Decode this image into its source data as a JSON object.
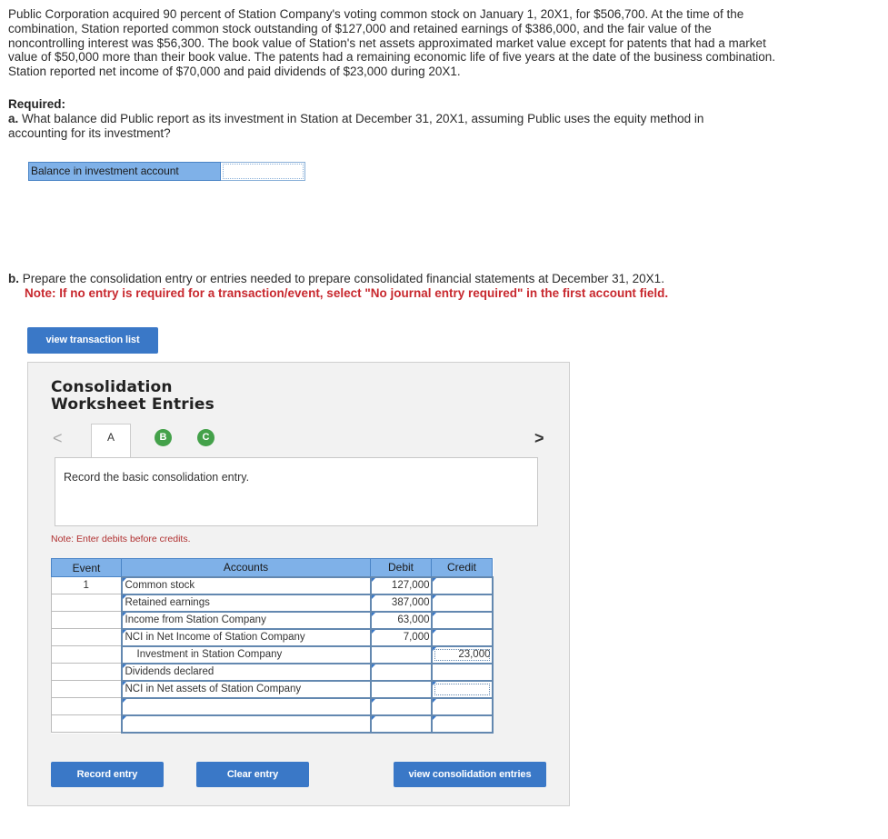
{
  "problem_text": "Public Corporation acquired 90 percent of Station Company's voting common stock on January 1, 20X1, for $506,700. At the time of the combination, Station reported common stock outstanding of $127,000 and retained earnings of $386,000, and the fair value of the noncontrolling interest was $56,300. The book value of Station's net assets approximated market value except for patents that had a market value of $50,000 more than their book value. The patents had a remaining economic life of five years at the date of the business combination. Station reported net income of $70,000 and paid dividends of $23,000 during 20X1.",
  "required_heading": "Required:",
  "part_a": {
    "letter": "a.",
    "question": "What balance did Public report as its investment in Station at December 31, 20X1, assuming Public uses the equity method in accounting for its investment?",
    "balance_label": "Balance in investment account",
    "balance_value": ""
  },
  "part_b": {
    "letter": "b.",
    "question": "Prepare the consolidation entry or entries needed to prepare consolidated financial statements at December 31, 20X1.",
    "note": "Note: If no entry is required for a transaction/event, select \"No journal entry required\" in the first account field."
  },
  "buttons": {
    "view_transaction_list": "view transaction list",
    "record_entry": "Record entry",
    "clear_entry": "Clear entry",
    "view_consolidation_entries": "view consolidation entries"
  },
  "worksheet": {
    "title_line1": "Consolidation",
    "title_line2": "Worksheet Entries",
    "nav_prev": "<",
    "nav_next": ">",
    "tabs": [
      "A",
      "B",
      "C"
    ],
    "instruction": "Record the basic consolidation entry.",
    "note": "Note: Enter debits before credits.",
    "headers": {
      "event": "Event",
      "accounts": "Accounts",
      "debit": "Debit",
      "credit": "Credit"
    },
    "rows": [
      {
        "event": "1",
        "account": "Common stock",
        "debit": "127,000",
        "credit": ""
      },
      {
        "event": "",
        "account": "Retained earnings",
        "debit": "387,000",
        "credit": ""
      },
      {
        "event": "",
        "account": "Income from Station Company",
        "debit": "63,000",
        "credit": ""
      },
      {
        "event": "",
        "account": "NCI in Net Income of Station Company",
        "debit": "7,000",
        "credit": ""
      },
      {
        "event": "",
        "account": "Investment in Station Company",
        "debit": "",
        "credit": "23,000"
      },
      {
        "event": "",
        "account": "Dividends declared",
        "debit": "",
        "credit": ""
      },
      {
        "event": "",
        "account": "NCI in Net assets of Station Company",
        "debit": "",
        "credit": ""
      },
      {
        "event": "",
        "account": "",
        "debit": "",
        "credit": ""
      },
      {
        "event": "",
        "account": "",
        "debit": "",
        "credit": ""
      }
    ]
  },
  "colors": {
    "header_blue": "#7fb1e8",
    "button_blue": "#3a78c7",
    "tab_green": "#44a14a",
    "note_red": "#c8282e"
  }
}
